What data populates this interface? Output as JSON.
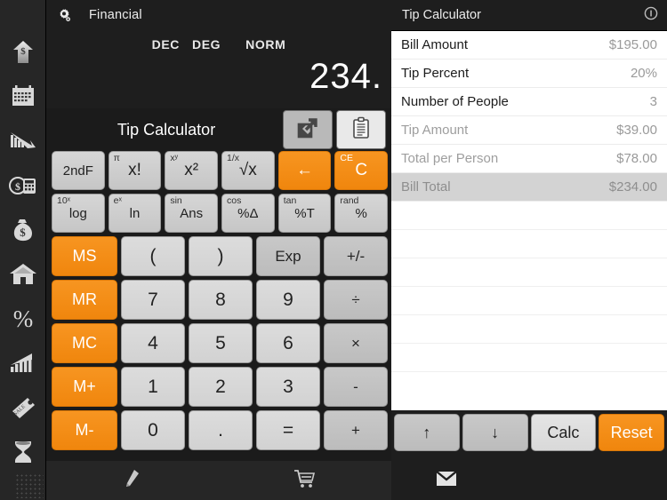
{
  "window": {
    "app_title": "Financial",
    "gear_icon": "gear-icon"
  },
  "sidebar": {
    "items": [
      {
        "icon": "dollar-arrow-up-icon",
        "name": "sidebar-item-investment"
      },
      {
        "icon": "calendar-icon",
        "name": "sidebar-item-loan-schedule"
      },
      {
        "icon": "chart-declining-icon",
        "name": "sidebar-item-depreciation"
      },
      {
        "icon": "calculator-dollar-icon",
        "name": "sidebar-item-calculator"
      },
      {
        "icon": "money-bag-icon",
        "name": "sidebar-item-savings"
      },
      {
        "icon": "house-icon",
        "name": "sidebar-item-mortgage"
      },
      {
        "icon": "percent-icon",
        "name": "sidebar-item-percent"
      },
      {
        "icon": "chart-growth-icon",
        "name": "sidebar-item-growth"
      },
      {
        "icon": "sale-tag-icon",
        "name": "sidebar-item-discount"
      },
      {
        "icon": "hourglass-icon",
        "name": "sidebar-item-time-value"
      }
    ],
    "handle": "resize-handle"
  },
  "calculator": {
    "modes": [
      "DEC",
      "DEG",
      "NORM"
    ],
    "display_value": "234.",
    "sub_label": "Tip Calculator",
    "share_icon": "share-export-icon",
    "clipboard_icon": "clipboard-icon",
    "rows": [
      [
        {
          "label": "2ndF",
          "sup": "",
          "style": "fn",
          "small": true
        },
        {
          "label": "x!",
          "sup": "π",
          "style": "fn"
        },
        {
          "label": "x²",
          "sup": "xʸ",
          "style": "fn"
        },
        {
          "label": "√x",
          "sup": "1/x",
          "style": "fn"
        },
        {
          "label": "←",
          "sup": "",
          "style": "orange"
        },
        {
          "label": "C",
          "sup": "CE",
          "style": "orange"
        }
      ],
      [
        {
          "label": "log",
          "sup": "10ˣ",
          "style": "fn",
          "small": true
        },
        {
          "label": "ln",
          "sup": "eˣ",
          "style": "fn",
          "small": true
        },
        {
          "label": "Ans",
          "sup": "sin",
          "style": "fn",
          "small": true
        },
        {
          "label": "%Δ",
          "sup": "cos",
          "style": "fn",
          "small": true
        },
        {
          "label": "%T",
          "sup": "tan",
          "style": "fn",
          "small": true
        },
        {
          "label": "%",
          "sup": "rand",
          "style": "fn",
          "small": true
        }
      ]
    ],
    "pad": [
      [
        {
          "label": "MS",
          "style": "mem"
        },
        {
          "label": "(",
          "style": "num"
        },
        {
          "label": ")",
          "style": "num"
        },
        {
          "label": "Exp",
          "style": "op",
          "small": true
        },
        {
          "label": "+/-",
          "style": "op"
        }
      ],
      [
        {
          "label": "MR",
          "style": "mem"
        },
        {
          "label": "7",
          "style": "num"
        },
        {
          "label": "8",
          "style": "num"
        },
        {
          "label": "9",
          "style": "num"
        },
        {
          "label": "÷",
          "style": "op"
        }
      ],
      [
        {
          "label": "MC",
          "style": "mem"
        },
        {
          "label": "4",
          "style": "num"
        },
        {
          "label": "5",
          "style": "num"
        },
        {
          "label": "6",
          "style": "num"
        },
        {
          "label": "×",
          "style": "op"
        }
      ],
      [
        {
          "label": "M+",
          "style": "mem"
        },
        {
          "label": "1",
          "style": "num"
        },
        {
          "label": "2",
          "style": "num"
        },
        {
          "label": "3",
          "style": "num"
        },
        {
          "label": "-",
          "style": "op"
        }
      ],
      [
        {
          "label": "M-",
          "style": "mem"
        },
        {
          "label": "0",
          "style": "num"
        },
        {
          "label": ".",
          "style": "num"
        },
        {
          "label": "=",
          "style": "num"
        },
        {
          "label": "+",
          "style": "op"
        }
      ]
    ],
    "bottom_icons": [
      {
        "icon": "highlighter-pen-icon",
        "name": "annotate-button"
      },
      {
        "icon": "shopping-cart-icon",
        "name": "store-button"
      }
    ]
  },
  "panel": {
    "title": "Tip Calculator",
    "info_icon": "info-icon",
    "rows": [
      {
        "label": "Bill Amount",
        "value": "$195.00",
        "computed": false,
        "selected": false
      },
      {
        "label": "Tip Percent",
        "value": "20%",
        "computed": false,
        "selected": false
      },
      {
        "label": "Number of People",
        "value": "3",
        "computed": false,
        "selected": false
      },
      {
        "label": "Tip Amount",
        "value": "$39.00",
        "computed": true,
        "selected": false
      },
      {
        "label": "Total per Person",
        "value": "$78.00",
        "computed": true,
        "selected": false
      },
      {
        "label": "Bill Total",
        "value": "$234.00",
        "computed": true,
        "selected": true
      }
    ],
    "empty_row_count": 6,
    "buttons": [
      {
        "label": "↑",
        "style": "",
        "name": "previous-field-button"
      },
      {
        "label": "↓",
        "style": "",
        "name": "next-field-button"
      },
      {
        "label": "Calc",
        "style": "light",
        "name": "calc-button"
      },
      {
        "label": "Reset",
        "style": "orange",
        "name": "reset-button"
      }
    ],
    "mail_icon": "envelope-icon"
  },
  "colors": {
    "accent_orange": "#f0860d",
    "panel_bg": "#ffffff",
    "chrome_dark": "#1e1e1e",
    "key_gray": "#d2d2d2",
    "selected_row": "#d3d3d3"
  }
}
